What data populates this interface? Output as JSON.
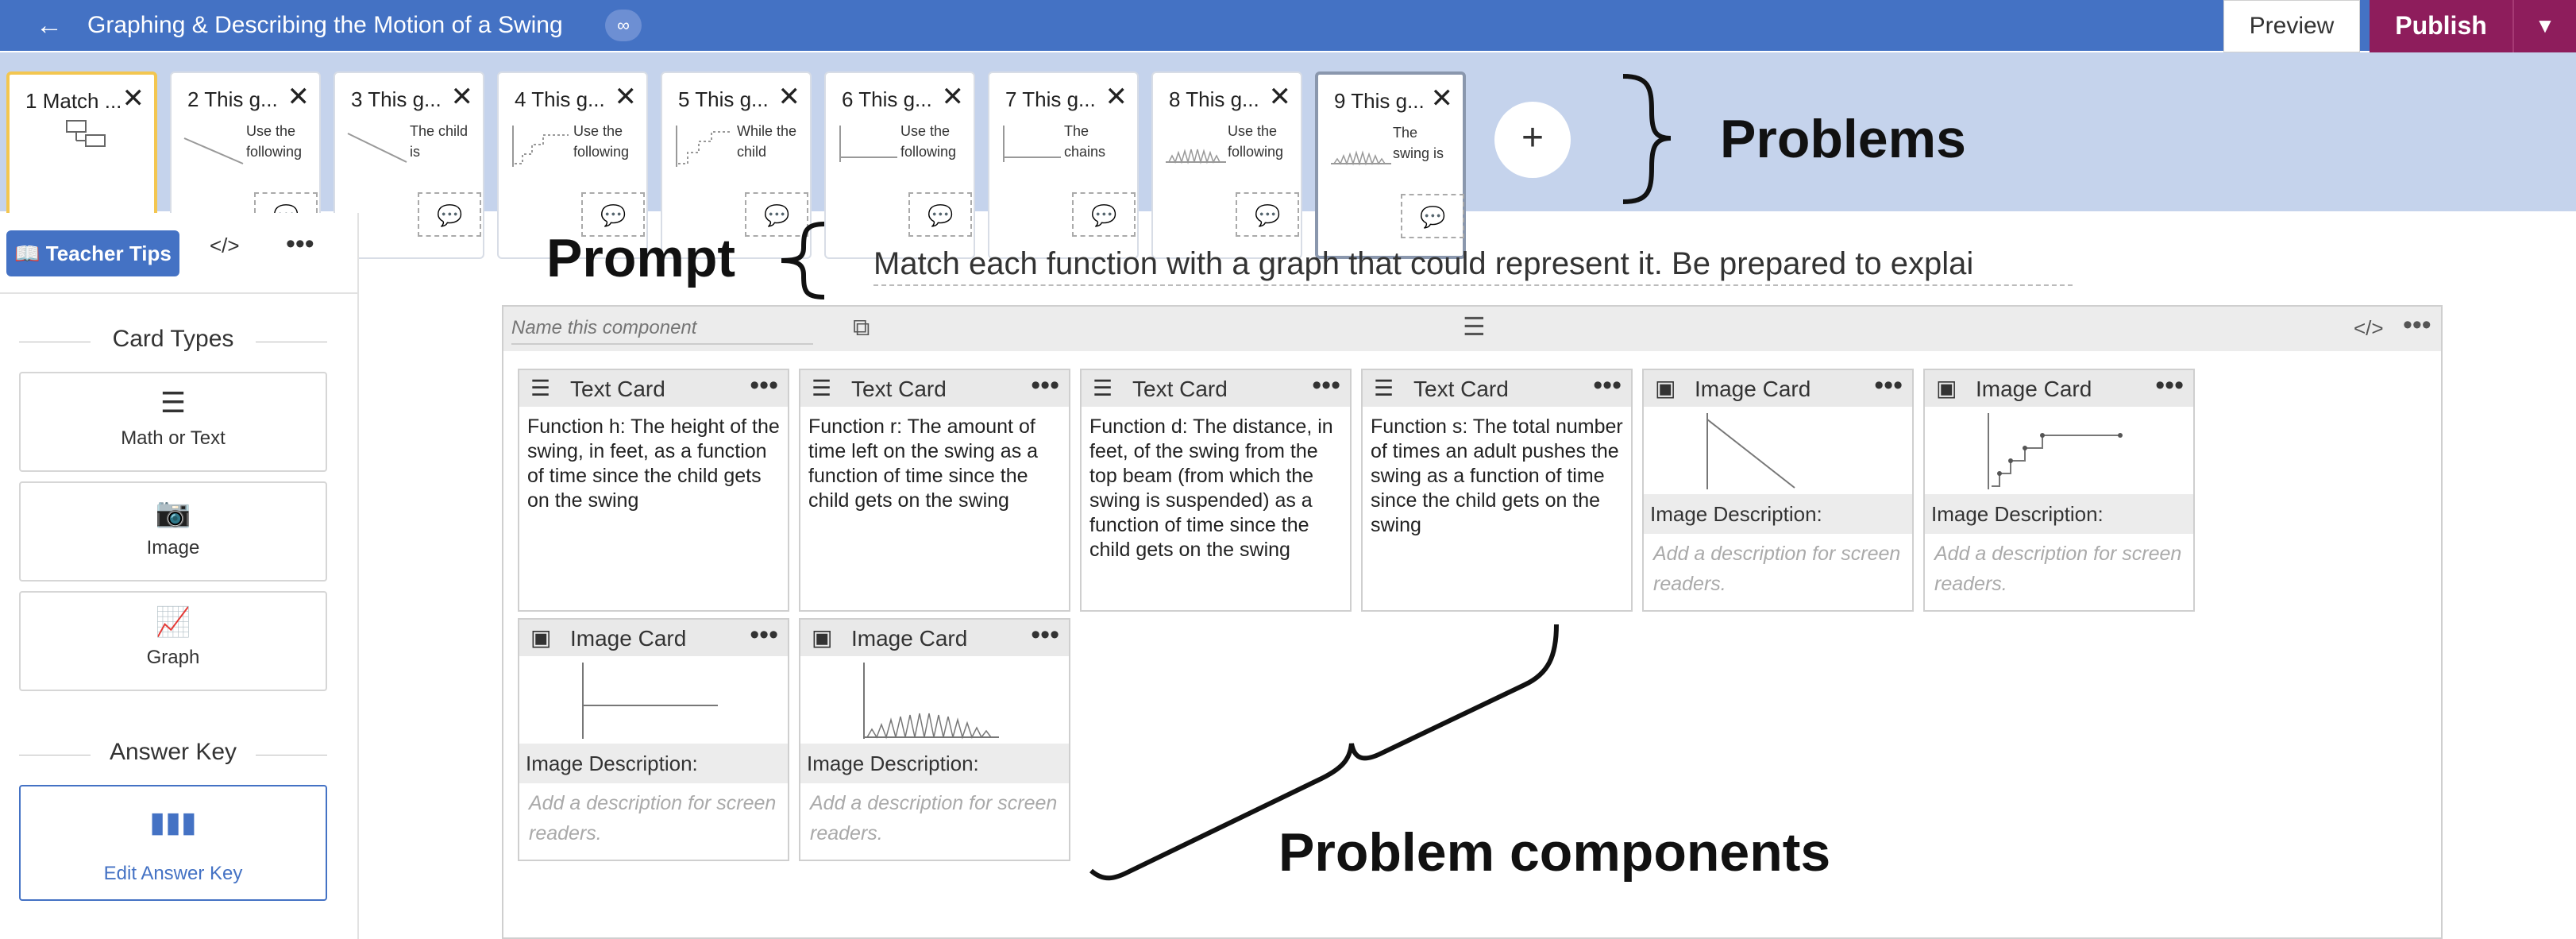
{
  "topbar": {
    "back_icon": "arrow-left-icon",
    "title": "Graphing & Describing the Motion of a Swing",
    "link_icon": "link-icon",
    "preview_label": "Preview",
    "publish_label": "Publish",
    "publish_menu_icon": "caret-down-icon"
  },
  "problems": [
    {
      "num": "1",
      "label": "Match ...",
      "mini": ""
    },
    {
      "num": "2",
      "label": "This g...",
      "mini": "Use the following"
    },
    {
      "num": "3",
      "label": "This g...",
      "mini": "The child is"
    },
    {
      "num": "4",
      "label": "This g...",
      "mini": "Use the following"
    },
    {
      "num": "5",
      "label": "This g...",
      "mini": "While the child"
    },
    {
      "num": "6",
      "label": "This g...",
      "mini": "Use the following"
    },
    {
      "num": "7",
      "label": "This g...",
      "mini": "The chains"
    },
    {
      "num": "8",
      "label": "This g...",
      "mini": "Use the following"
    },
    {
      "num": "9",
      "label": "This g...",
      "mini": "The swing is"
    }
  ],
  "add_problem_label": "+",
  "annotations": {
    "problems": "Problems",
    "prompt": "Prompt",
    "components": "Problem components"
  },
  "sidebar": {
    "teacher_tips": "Teacher Tips",
    "code_label": "</>",
    "more_label": "•••",
    "card_types_heading": "Card Types",
    "card_types": [
      {
        "icon": "text-lines-icon",
        "label": "Math or Text"
      },
      {
        "icon": "image-icon",
        "label": "Image"
      },
      {
        "icon": "graph-icon",
        "label": "Graph"
      }
    ],
    "answer_key_heading": "Answer Key",
    "answer_key_button": "Edit Answer Key"
  },
  "prompt": "Match each function with a graph that could represent it. Be prepared to explai",
  "component": {
    "name_placeholder": "Name this component",
    "cards": [
      {
        "type": "Text Card",
        "func": "h",
        "text": "Function h: The height of the swing, in feet, as a function of time since the child gets on the swing"
      },
      {
        "type": "Text Card",
        "func": "r",
        "text": "Function r: The amount of time left on the swing as a function of time since the child gets on the swing"
      },
      {
        "type": "Text Card",
        "func": "d",
        "text": "Function d: The distance, in feet, of the swing from the top beam (from which the swing is suspended) as a function of time since the child gets on the swing"
      },
      {
        "type": "Text Card",
        "func": "s",
        "text": "Function s: The total number of times an adult pushes the swing as a function of time since the child gets on the swing"
      }
    ],
    "image_cards": [
      {
        "type": "Image Card",
        "desc_label": "Image Description:",
        "placeholder": "Add a description for screen readers."
      },
      {
        "type": "Image Card",
        "desc_label": "Image Description:",
        "placeholder": "Add a description for screen readers."
      },
      {
        "type": "Image Card",
        "desc_label": "Image Description:",
        "placeholder": "Add a description for screen readers."
      },
      {
        "type": "Image Card",
        "desc_label": "Image Description:",
        "placeholder": "Add a description for screen readers."
      }
    ]
  }
}
